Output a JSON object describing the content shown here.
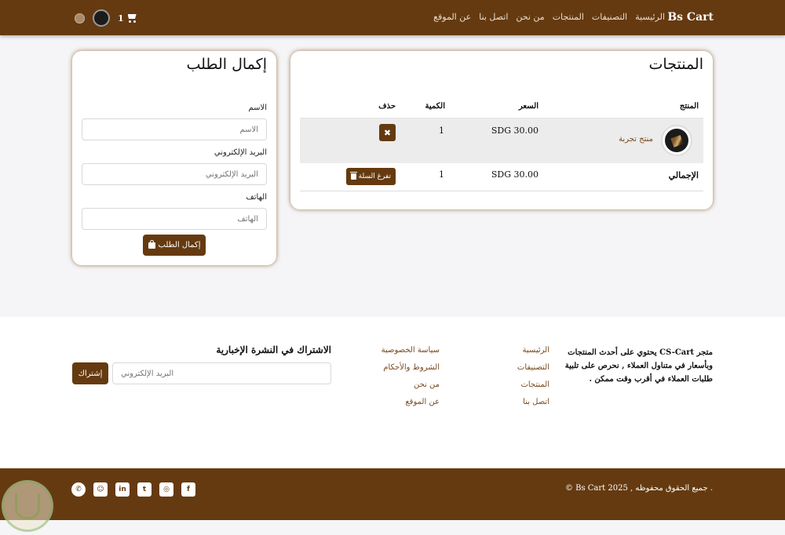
{
  "navbar": {
    "brand": "Bs Cart",
    "links": [
      "الرئيسية",
      "التصنيفات",
      "المنتجات",
      "من نحن",
      "اتصل بنا",
      "عن الموقع"
    ],
    "cart_count": "1"
  },
  "products": {
    "title": "المنتجات",
    "headers": {
      "product": "المنتج",
      "price": "السعر",
      "qty": "الكمية",
      "delete": "حذف"
    },
    "item": {
      "name": "منتج تجربة",
      "price": "SDG 30.00",
      "qty": "1",
      "delete_icon": "✖"
    },
    "total": {
      "label": "الإجمالي",
      "price": "SDG 30.00",
      "qty": "1",
      "empty_label": "تفرغ السلة"
    }
  },
  "checkout": {
    "title": "إكمال الطلب",
    "name_label": "الاسم",
    "name_placeholder": "الاسم",
    "email_label": "البريد الإلكتروني",
    "email_placeholder": "البريد الإلكتروني",
    "phone_label": "الهاتف",
    "phone_placeholder": "الهاتف",
    "submit_label": "إكمال الطلب"
  },
  "footer": {
    "about": "متجر CS-Cart يحتوي على أحدث المنتجات وبأسعار في متناول العملاء , نحرص على تلبية طلبات العملاء في أقرب وقت ممكن .",
    "links1": [
      "الرئيسية",
      "التصنيفات",
      "المنتجات",
      "اتصل بنا"
    ],
    "links2": [
      "سياسة الخصوصية",
      "الشروط والأحكام",
      "من نحن",
      "عن الموقع"
    ],
    "newsletter_title": "الاشتراك في النشرة الإخبارية",
    "newsletter_placeholder": "البريد الإلكتروني",
    "newsletter_button": "إشتراك",
    "copyright": "© Bs Cart 2025 , جميع الحقوق محفوظه .",
    "socials": [
      "whatsapp-icon",
      "snapchat-icon",
      "linkedin-icon",
      "twitter-icon",
      "instagram-icon",
      "facebook-icon"
    ]
  },
  "colors": {
    "brand": "#653a10",
    "link": "#7a4a1e"
  }
}
